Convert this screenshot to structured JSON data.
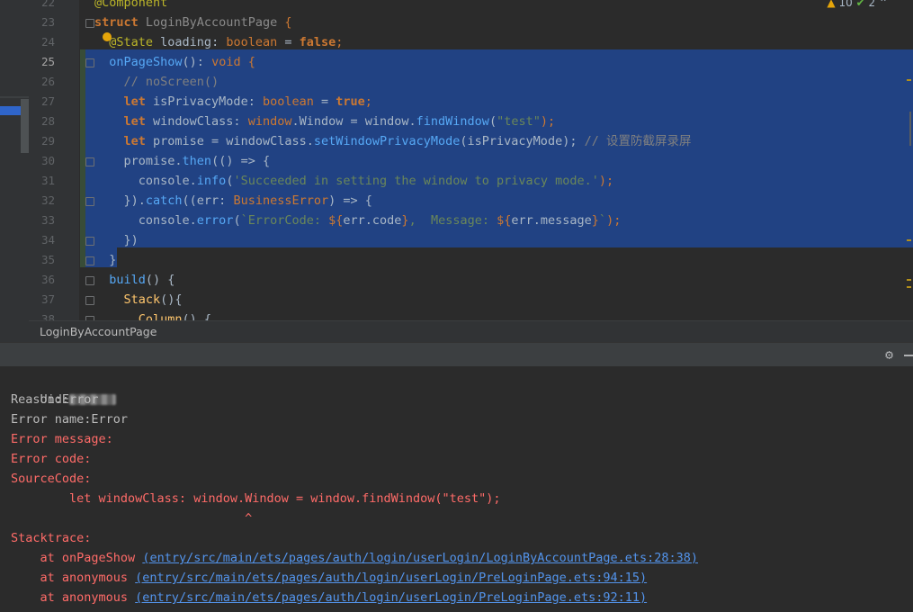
{
  "editor": {
    "lines": [
      {
        "num": "22",
        "tokens": [
          {
            "t": "@Component",
            "c": "ann"
          }
        ]
      },
      {
        "num": "23",
        "tokens": [
          {
            "t": "struct ",
            "c": "kw"
          },
          {
            "t": "LoginByAccountPage",
            "c": "cls"
          },
          {
            "t": " {",
            "c": "ty"
          }
        ]
      },
      {
        "num": "24",
        "tokens": [
          {
            "t": "  @State ",
            "c": "ann"
          },
          {
            "t": "loading",
            "c": ""
          },
          {
            "t": ": ",
            "c": ""
          },
          {
            "t": "boolean",
            "c": "ty"
          },
          {
            "t": " = ",
            "c": ""
          },
          {
            "t": "false",
            "c": "kw"
          },
          {
            "t": ";",
            "c": "ty"
          }
        ]
      },
      {
        "num": "25",
        "tokens": [
          {
            "t": "  onPageShow",
            "c": "fn2"
          },
          {
            "t": "(): ",
            "c": ""
          },
          {
            "t": "void",
            "c": "ty"
          },
          {
            "t": " {",
            "c": "ty"
          }
        ]
      },
      {
        "num": "26",
        "tokens": [
          {
            "t": "    // noScreen()",
            "c": "cm"
          }
        ]
      },
      {
        "num": "27",
        "tokens": [
          {
            "t": "    let ",
            "c": "kw"
          },
          {
            "t": "isPrivacyMode: ",
            "c": ""
          },
          {
            "t": "boolean",
            "c": "ty"
          },
          {
            "t": " = ",
            "c": ""
          },
          {
            "t": "true",
            "c": "kw"
          },
          {
            "t": ";",
            "c": "ty"
          }
        ]
      },
      {
        "num": "28",
        "tokens": [
          {
            "t": "    let ",
            "c": "kw"
          },
          {
            "t": "windowClass: ",
            "c": ""
          },
          {
            "t": "window",
            "c": "ty"
          },
          {
            "t": ".Window = window.",
            "c": ""
          },
          {
            "t": "findWindow",
            "c": "fn2"
          },
          {
            "t": "(",
            "c": ""
          },
          {
            "t": "\"test\"",
            "c": "str"
          },
          {
            "t": ");",
            "c": "ty"
          }
        ]
      },
      {
        "num": "29",
        "tokens": [
          {
            "t": "    let ",
            "c": "kw"
          },
          {
            "t": "promise = windowClass.",
            "c": ""
          },
          {
            "t": "setWindowPrivacyMode",
            "c": "fn2"
          },
          {
            "t": "(isPrivacyMode); ",
            "c": ""
          },
          {
            "t": "// 设置防截屏录屏",
            "c": "cm"
          }
        ]
      },
      {
        "num": "30",
        "tokens": [
          {
            "t": "    promise.",
            "c": ""
          },
          {
            "t": "then",
            "c": "fn2"
          },
          {
            "t": "(() => {",
            "c": ""
          }
        ]
      },
      {
        "num": "31",
        "tokens": [
          {
            "t": "      console.",
            "c": ""
          },
          {
            "t": "info",
            "c": "fn2"
          },
          {
            "t": "(",
            "c": ""
          },
          {
            "t": "'Succeeded in setting the window to privacy mode.'",
            "c": "str"
          },
          {
            "t": ");",
            "c": "ty"
          }
        ]
      },
      {
        "num": "32",
        "tokens": [
          {
            "t": "    }).",
            "c": ""
          },
          {
            "t": "catch",
            "c": "fn2"
          },
          {
            "t": "((err: ",
            "c": ""
          },
          {
            "t": "BusinessError",
            "c": "ty"
          },
          {
            "t": ") => {",
            "c": ""
          }
        ]
      },
      {
        "num": "33",
        "tokens": [
          {
            "t": "      console.",
            "c": ""
          },
          {
            "t": "error",
            "c": "fn2"
          },
          {
            "t": "(",
            "c": ""
          },
          {
            "t": "`ErrorCode: ",
            "c": "str"
          },
          {
            "t": "${",
            "c": "ty"
          },
          {
            "t": "err.code",
            "c": ""
          },
          {
            "t": "}",
            "c": "ty"
          },
          {
            "t": ",  Message: ",
            "c": "str"
          },
          {
            "t": "${",
            "c": "ty"
          },
          {
            "t": "err.message",
            "c": ""
          },
          {
            "t": "}",
            "c": "ty"
          },
          {
            "t": "`",
            "c": "str"
          },
          {
            "t": ");",
            "c": "ty"
          }
        ]
      },
      {
        "num": "34",
        "tokens": [
          {
            "t": "    })",
            "c": ""
          }
        ]
      },
      {
        "num": "35",
        "tokens": [
          {
            "t": "  }",
            "c": ""
          }
        ]
      },
      {
        "num": "36",
        "tokens": [
          {
            "t": "  build",
            "c": "fn2"
          },
          {
            "t": "() {",
            "c": ""
          }
        ]
      },
      {
        "num": "37",
        "tokens": [
          {
            "t": "    Stack",
            "c": "fn"
          },
          {
            "t": "(){",
            "c": ""
          }
        ]
      },
      {
        "num": "38",
        "tokens": [
          {
            "t": "      Column",
            "c": "fn"
          },
          {
            "t": "() {",
            "c": ""
          }
        ]
      }
    ],
    "inspection_warnings": "10",
    "inspection_ok": "2"
  },
  "breadcrumb": "LoginByAccountPage",
  "console": {
    "uid_label": "Uid:",
    "reason": "Reason:Error",
    "error_name": "Error name:Error",
    "error_message": "Error message:",
    "error_code": "Error code:",
    "source_code_label": "SourceCode:",
    "source_line": "        let windowClass: window.Window = window.findWindow(\"test\");",
    "caret": "                                ^",
    "stacktrace_label": "Stacktrace:",
    "frames": [
      {
        "prefix": "    at onPageShow ",
        "link": "(entry/src/main/ets/pages/auth/login/userLogin/LoginByAccountPage.ets:28:38)"
      },
      {
        "prefix": "    at anonymous ",
        "link": "(entry/src/main/ets/pages/auth/login/userLogin/PreLoginPage.ets:94:15)"
      },
      {
        "prefix": "    at anonymous ",
        "link": "(entry/src/main/ets/pages/auth/login/userLogin/PreLoginPage.ets:92:11)"
      }
    ]
  }
}
